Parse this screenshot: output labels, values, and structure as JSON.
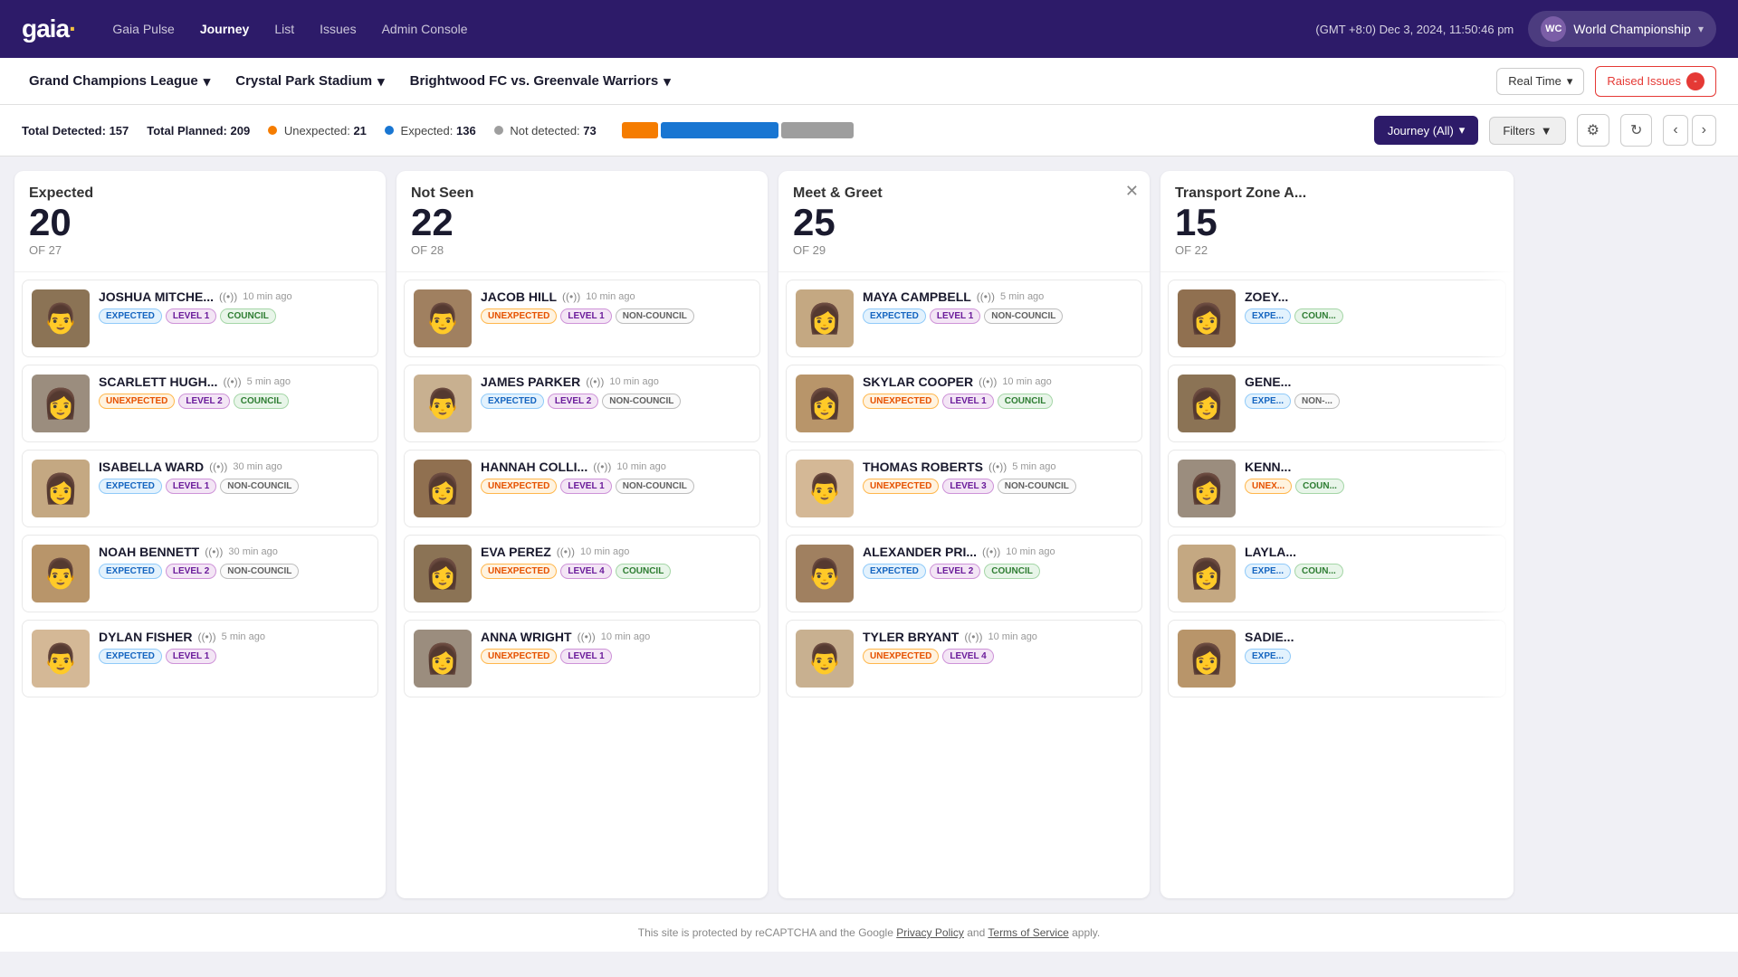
{
  "header": {
    "logo": "gaia",
    "logo_dot": "·",
    "nav": [
      {
        "label": "Gaia Pulse",
        "active": false
      },
      {
        "label": "Journey",
        "active": true
      },
      {
        "label": "List",
        "active": false
      },
      {
        "label": "Issues",
        "active": false
      },
      {
        "label": "Admin Console",
        "active": false
      }
    ],
    "datetime": "(GMT +8:0) Dec 3, 2024, 11:50:46 pm",
    "wc_initials": "WC",
    "wc_label": "World Championship",
    "chevron": "▾"
  },
  "sub_header": {
    "league": "Grand Champions League",
    "stadium": "Crystal Park Stadium",
    "match": "Brightwood FC vs. Greenvale Warriors",
    "real_time": "Real Time",
    "raised_issues": "Raised Issues",
    "raised_count": "-"
  },
  "stats": {
    "total_detected_label": "Total Detected:",
    "total_detected": "157",
    "total_planned_label": "Total Planned:",
    "total_planned": "209",
    "unexpected_label": "Unexpected:",
    "unexpected": "21",
    "expected_label": "Expected:",
    "expected": "136",
    "not_detected_label": "Not detected:",
    "not_detected": "73",
    "journey_btn": "Journey (All)",
    "filters_btn": "Filters"
  },
  "columns": [
    {
      "id": "expected",
      "title": "Expected",
      "count": "20",
      "of": "OF 27",
      "closeable": false,
      "persons": [
        {
          "name": "JOSHUA MITCHE...",
          "time": "10 min ago",
          "tags": [
            "EXPECTED",
            "LEVEL 1",
            "COUNCIL"
          ],
          "face": "👨"
        },
        {
          "name": "SCARLETT HUGH...",
          "time": "5 min ago",
          "tags": [
            "UNEXPECTED",
            "LEVEL 2",
            "COUNCIL"
          ],
          "face": "👩"
        },
        {
          "name": "ISABELLA WARD",
          "time": "30 min ago",
          "tags": [
            "EXPECTED",
            "LEVEL 1",
            "NON-COUNCIL"
          ],
          "face": "👩"
        },
        {
          "name": "NOAH BENNETT",
          "time": "30 min ago",
          "tags": [
            "EXPECTED",
            "LEVEL 2",
            "NON-COUNCIL"
          ],
          "face": "👨"
        },
        {
          "name": "DYLAN FISHER",
          "time": "5 min ago",
          "tags": [
            "EXPECTED",
            "LEVEL 1"
          ],
          "face": "👨"
        }
      ]
    },
    {
      "id": "not-seen",
      "title": "Not Seen",
      "count": "22",
      "of": "OF 28",
      "closeable": false,
      "persons": [
        {
          "name": "JACOB HILL",
          "time": "10 min ago",
          "tags": [
            "UNEXPECTED",
            "LEVEL 1",
            "NON-COUNCIL"
          ],
          "face": "👨"
        },
        {
          "name": "JAMES PARKER",
          "time": "10 min ago",
          "tags": [
            "EXPECTED",
            "LEVEL 2",
            "NON-COUNCIL"
          ],
          "face": "👨"
        },
        {
          "name": "HANNAH COLLI...",
          "time": "10 min ago",
          "tags": [
            "UNEXPECTED",
            "LEVEL 1",
            "NON-COUNCIL"
          ],
          "face": "👩"
        },
        {
          "name": "EVA PEREZ",
          "time": "10 min ago",
          "tags": [
            "UNEXPECTED",
            "LEVEL 4",
            "COUNCIL"
          ],
          "face": "👩"
        },
        {
          "name": "ANNA WRIGHT",
          "time": "10 min ago",
          "tags": [
            "UNEXPECTED",
            "LEVEL 1"
          ],
          "face": "👩"
        }
      ]
    },
    {
      "id": "meet-greet",
      "title": "Meet & Greet",
      "count": "25",
      "of": "OF 29",
      "closeable": true,
      "persons": [
        {
          "name": "MAYA CAMPBELL",
          "time": "5 min ago",
          "tags": [
            "EXPECTED",
            "LEVEL 1",
            "NON-COUNCIL"
          ],
          "face": "👩"
        },
        {
          "name": "SKYLAR COOPER",
          "time": "10 min ago",
          "tags": [
            "UNEXPECTED",
            "LEVEL 1",
            "COUNCIL"
          ],
          "face": "👩"
        },
        {
          "name": "THOMAS ROBERTS",
          "time": "5 min ago",
          "tags": [
            "UNEXPECTED",
            "LEVEL 3",
            "NON-COUNCIL"
          ],
          "face": "👨"
        },
        {
          "name": "ALEXANDER PRI...",
          "time": "10 min ago",
          "tags": [
            "EXPECTED",
            "LEVEL 2",
            "COUNCIL"
          ],
          "face": "👨"
        },
        {
          "name": "TYLER BRYANT",
          "time": "10 min ago",
          "tags": [
            "UNEXPECTED",
            "LEVEL 4"
          ],
          "face": "👨"
        }
      ]
    },
    {
      "id": "transport-zone",
      "title": "Transport Zone A...",
      "count": "15",
      "of": "OF 22",
      "closeable": false,
      "partial": true,
      "persons": [
        {
          "name": "ZOEY...",
          "time": "",
          "tags": [
            "EXPE...",
            "COUN..."
          ],
          "face": "👩"
        },
        {
          "name": "GENE...",
          "time": "",
          "tags": [
            "EXPE...",
            "NON-..."
          ],
          "face": "👩"
        },
        {
          "name": "KENN...",
          "time": "",
          "tags": [
            "UNEX...",
            "COUN..."
          ],
          "face": "👩"
        },
        {
          "name": "LAYLA...",
          "time": "",
          "tags": [
            "EXPE...",
            "COUN..."
          ],
          "face": "👩"
        },
        {
          "name": "SADIE...",
          "time": "",
          "tags": [
            "EXPE..."
          ],
          "face": "👩"
        }
      ]
    }
  ],
  "footer": {
    "text1": "This site is protected by reCAPTCHA and the Google ",
    "privacy_policy": "Privacy Policy",
    "text2": " and ",
    "terms": "Terms of Service",
    "text3": " apply."
  }
}
